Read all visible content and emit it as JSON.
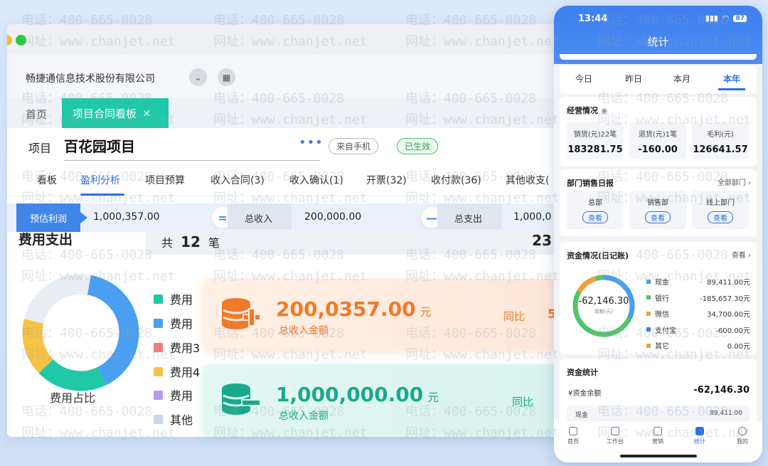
{
  "watermark": {
    "phone": "电话：400-665-0028",
    "site": "网址：www.chanjet.net"
  },
  "desktop": {
    "company": "畅捷通信息技术股份有限公司",
    "tabs": {
      "home": "首页",
      "active": "项目合同看板",
      "close": "×"
    },
    "project": {
      "label": "项目",
      "name": "百花园项目",
      "more": "•••",
      "source": "来自手机",
      "status": "已生效"
    },
    "nav": [
      "看板",
      "盈利分析",
      "项目预算",
      "收入合同(3)",
      "收入确认(1)",
      "开票(32)",
      "收付款(36)",
      "其他收支("
    ],
    "profit": {
      "tag": "预估利润",
      "profit_value": "1,000,357.00",
      "eq": "=",
      "income_label": "总收入",
      "income_value": "200,000.00",
      "minus": "—",
      "expense_label": "总支出",
      "expense_value": "1,000,0"
    },
    "expense": {
      "title": "费用支出",
      "count_prefix": "共",
      "count": "12",
      "count_suffix": "笔",
      "count_right": "23",
      "ratio_label": "费用占比",
      "legend": [
        {
          "label": "费用",
          "color": "#1fc9a8"
        },
        {
          "label": "费用",
          "color": "#4a9ff0"
        },
        {
          "label": "费用3",
          "color": "#f27d7d"
        },
        {
          "label": "费用4",
          "color": "#f6c344"
        },
        {
          "label": "费用",
          "color": "#b59af0"
        },
        {
          "label": "其他",
          "color": "#c8d7ec"
        }
      ],
      "donut": [
        {
          "value": 40,
          "color": "#4a9ff0"
        },
        {
          "value": 20,
          "color": "#1fc9a8"
        },
        {
          "value": 16,
          "color": "#f6c344"
        },
        {
          "value": 24,
          "color": "#e9eef5"
        }
      ]
    },
    "cards": {
      "income": {
        "amount": "200,0357.00",
        "unit": "元",
        "label": "总收入金额",
        "yoy": "同比",
        "yoy_value": "5"
      },
      "income2": {
        "amount": "1,000,000.00",
        "unit": "元",
        "label": "总收入金额",
        "yoy": "同比"
      }
    },
    "colors": {
      "accent": "#1fc9a8",
      "primary": "#2e6fe0",
      "orange": "#f07a2a",
      "teal": "#1aa98c"
    }
  },
  "phone": {
    "time": "13:44",
    "battery": "87",
    "title": "统计",
    "periods": [
      "今日",
      "昨日",
      "本月",
      "本年"
    ],
    "ops": {
      "title": "经营情况",
      "stats": [
        {
          "label": "销货(元)22笔",
          "value": "183281.75"
        },
        {
          "label": "退货(元)1笔",
          "value": "-160.00"
        },
        {
          "label": "毛利(元)",
          "value": "126641.57"
        }
      ]
    },
    "dept": {
      "title": "部门销售日报",
      "link": "全部部门",
      "items": [
        {
          "label": "总部",
          "btn": "查看"
        },
        {
          "label": "销售部",
          "btn": "查看"
        },
        {
          "label": "线上部门",
          "btn": "查看"
        }
      ]
    },
    "funds": {
      "title": "资金情况(日记账)",
      "link": "查看",
      "ring_value": "-62,146.30",
      "ring_label": "余额(元)",
      "rows": [
        {
          "label": "现金",
          "value": "89,411.00元",
          "color": "#4a9ff0"
        },
        {
          "label": "银行",
          "value": "-185,657.30元",
          "color": "#52c46a"
        },
        {
          "label": "微信",
          "value": "34,700.00元",
          "color": "#f2a03d"
        },
        {
          "label": "支付宝",
          "value": "-600.00元",
          "color": "#3a7be0"
        },
        {
          "label": "其它",
          "value": "0.00元",
          "color": "#f2a03d"
        }
      ]
    },
    "stats2": {
      "title": "资金统计",
      "balance_label": "¥资金余额",
      "balance_value": "-62,146.30",
      "row_label": "现金",
      "row_value": "89,411.00"
    },
    "nav": [
      "首页",
      "工作台",
      "营销",
      "统计",
      "我的"
    ]
  }
}
